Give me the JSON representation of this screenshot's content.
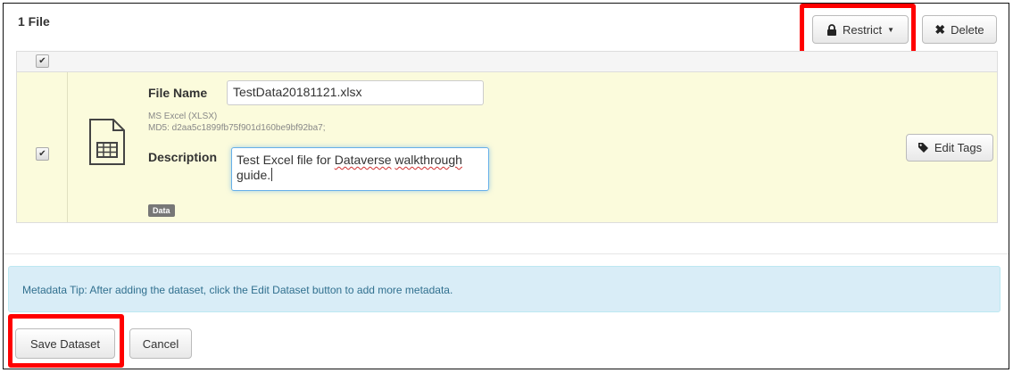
{
  "header": {
    "title": "1 File"
  },
  "toolbar": {
    "restrict_label": "Restrict",
    "delete_label": "Delete"
  },
  "file": {
    "name_label": "File Name",
    "name_value": "TestData20181121.xlsx",
    "type": "MS Excel (XLSX)",
    "md5": "MD5: d2aa5c1899fb75f901d160be9bf92ba7;",
    "description_label": "Description",
    "description_parts": {
      "p1": "Test Excel file for ",
      "p2": "Dataverse",
      "p3": " ",
      "p4": "walkthrough",
      "p5": " guide."
    },
    "tag": "Data",
    "edit_tags_label": "Edit Tags"
  },
  "tip": {
    "text": "Metadata Tip: After adding the dataset, click the Edit Dataset button to add more metadata."
  },
  "footer": {
    "save_label": "Save Dataset",
    "cancel_label": "Cancel"
  },
  "colors": {
    "highlight": "#ff0000",
    "row_bg": "#fbfbdc",
    "tip_bg": "#d9edf7",
    "tip_text": "#31708f"
  }
}
